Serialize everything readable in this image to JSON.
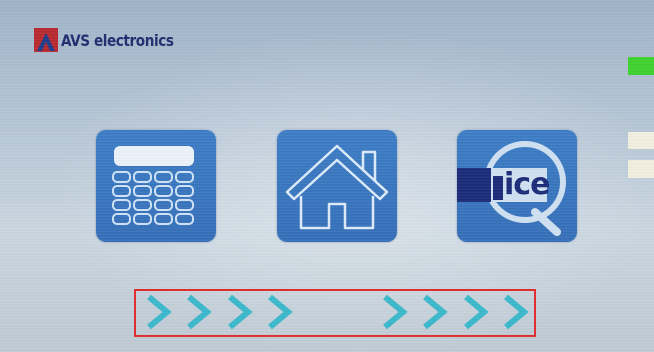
{
  "brand": {
    "name": "AVS electronics",
    "logo_icon": "avs-logo-mark",
    "color": "#1f2b6e"
  },
  "status": {
    "led_color": "#3dd22e"
  },
  "menu": {
    "tiles": [
      {
        "name": "calculator",
        "icon": "calculator-icon"
      },
      {
        "name": "home",
        "icon": "home-icon"
      },
      {
        "name": "ice-q",
        "icon": "ice-q-icon",
        "label": "ice"
      }
    ],
    "tile_color": "#3a79c2"
  },
  "navigation": {
    "left_arrows": 4,
    "right_arrows": 4,
    "arrow_color": "#3ab8cc",
    "frame_color": "#e02a2a"
  }
}
